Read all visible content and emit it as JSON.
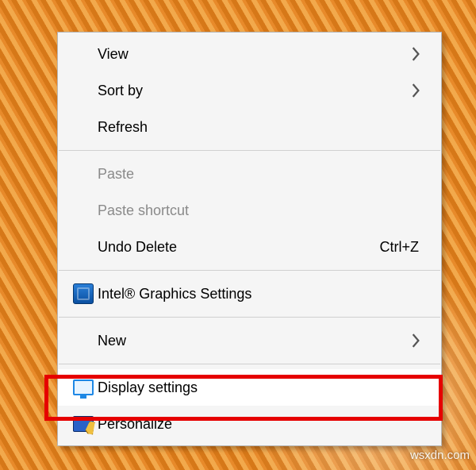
{
  "menu": {
    "view": {
      "label": "View",
      "has_submenu": true
    },
    "sort_by": {
      "label": "Sort by",
      "has_submenu": true
    },
    "refresh": {
      "label": "Refresh"
    },
    "paste": {
      "label": "Paste",
      "disabled": true
    },
    "paste_shortcut": {
      "label": "Paste shortcut",
      "disabled": true
    },
    "undo_delete": {
      "label": "Undo Delete",
      "accel": "Ctrl+Z"
    },
    "intel": {
      "label": "Intel® Graphics Settings"
    },
    "new": {
      "label": "New",
      "has_submenu": true
    },
    "display": {
      "label": "Display settings",
      "highlighted": true
    },
    "personalize": {
      "label": "Personalize"
    }
  },
  "watermark": "wsxdn.com"
}
